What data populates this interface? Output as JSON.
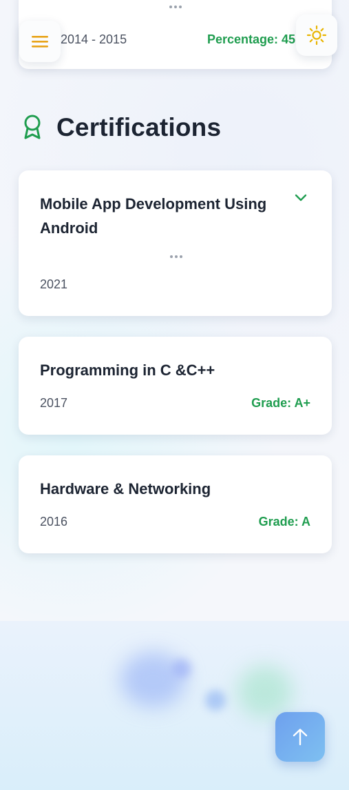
{
  "education_card": {
    "year": "2014 - 2015",
    "percentage": "Percentage: 45"
  },
  "section": {
    "title": "Certifications",
    "icon": "award-ribbon-icon"
  },
  "certifications": [
    {
      "title": "Mobile App Development Using Android",
      "year": "2021",
      "grade": "",
      "expanded_icon": "chevron-down-icon"
    },
    {
      "title": "Programming in C &C++",
      "year": "2017",
      "grade": "Grade: A+"
    },
    {
      "title": "Hardware & Networking",
      "year": "2016",
      "grade": "Grade: A"
    }
  ],
  "controls": {
    "menu_icon": "hamburger-menu-icon",
    "theme_icon": "sun-icon",
    "scroll_icon": "arrow-up-icon"
  },
  "colors": {
    "accent_green": "#1f9d4f",
    "menu_icon": "#e8a317",
    "sun_icon": "#e8b400",
    "text_dark": "#1c2432",
    "scroll_button": "#6ea0ee"
  }
}
